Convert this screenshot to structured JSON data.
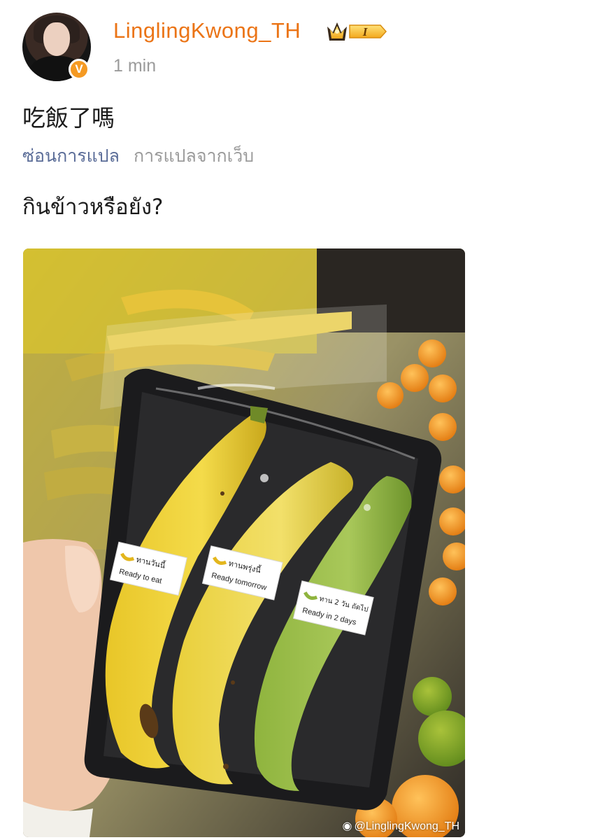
{
  "post": {
    "username": "LinglingKwong_TH",
    "time": "1 min",
    "badge_level": "I",
    "text": "吃飯了嗎",
    "hide_translation_label": "ซ่อนการแปล",
    "translation_source": "การแปลจากเว็บ",
    "translated_text": "กินข้าวหรือยัง?"
  },
  "image": {
    "label_1_thai": "ทานวันนี้",
    "label_1_en": "Ready to eat",
    "label_2_thai": "ทานพรุ่งนี้",
    "label_2_en": "Ready tomorrow",
    "label_3_thai": "ทาน 2 วัน ถัดไป",
    "label_3_en": "Ready in 2 days",
    "watermark": "@LinglingKwong_TH"
  },
  "colors": {
    "username": "#eb7416",
    "verified": "#f59a23",
    "link": "#5b6d98",
    "muted": "#9b9b9b"
  }
}
